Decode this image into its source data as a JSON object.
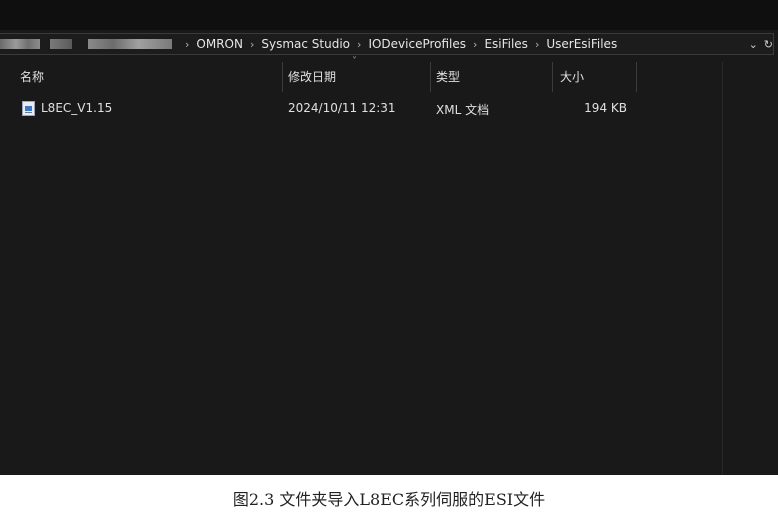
{
  "address_bar": {
    "path": [
      "OMRON",
      "Sysmac Studio",
      "IODeviceProfiles",
      "EsiFiles",
      "UserEsiFiles"
    ],
    "separator": "›",
    "dropdown_glyph": "⌄",
    "refresh_glyph": "↻"
  },
  "columns": {
    "name": "名称",
    "date": "修改日期",
    "type": "类型",
    "size": "大小",
    "sort_indicator": "˅"
  },
  "files": [
    {
      "name": "L8EC_V1.15",
      "modified": "2024/10/11 12:31",
      "type": "XML 文档",
      "size": "194 KB",
      "icon": "xml-file-icon"
    }
  ],
  "caption": "图2.3 文件夹导入L8EC系列伺服的ESI文件",
  "colors": {
    "background": "#191919",
    "text": "#e0e0e0",
    "separator": "#3c3c3c"
  }
}
